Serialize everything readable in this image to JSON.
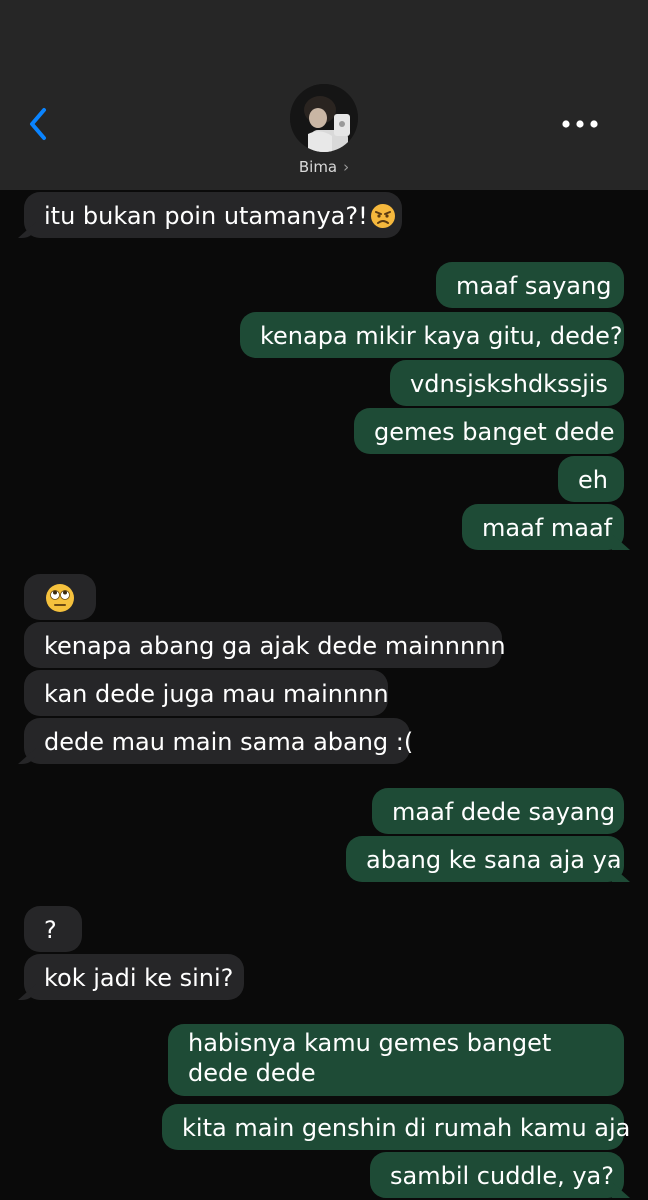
{
  "header": {
    "contact_name": "Bima",
    "contact_chevron": "›",
    "back_icon": "chevron-left-icon",
    "more_icon": "ellipsis-icon",
    "accent_color": "#0a84ff"
  },
  "colors": {
    "sent_bubble": "#1e4b36",
    "received_bubble": "#262628",
    "background": "#0a0a0a",
    "header_bg": "#262626"
  },
  "messages": [
    {
      "dir": "received",
      "text": "itu bukan poin utamanya?!",
      "emoji": "angry-face-icon"
    },
    {
      "dir": "sent",
      "text": "maaf sayang"
    },
    {
      "dir": "sent",
      "text": "kenapa mikir kaya gitu, dede?"
    },
    {
      "dir": "sent",
      "text": "vdnsjskshdkssjis"
    },
    {
      "dir": "sent",
      "text": "gemes banget dede"
    },
    {
      "dir": "sent",
      "text": "eh"
    },
    {
      "dir": "sent",
      "text": "maaf maaf"
    },
    {
      "dir": "received",
      "text": "",
      "emoji": "face-with-rolling-eyes-icon"
    },
    {
      "dir": "received",
      "text": "kenapa abang ga ajak dede mainnnnn"
    },
    {
      "dir": "received",
      "text": "kan dede juga mau mainnnn"
    },
    {
      "dir": "received",
      "text": "dede mau main sama abang :("
    },
    {
      "dir": "sent",
      "text": "maaf dede sayang"
    },
    {
      "dir": "sent",
      "text": "abang ke sana aja ya"
    },
    {
      "dir": "received",
      "text": "?"
    },
    {
      "dir": "received",
      "text": "kok jadi ke sini?"
    },
    {
      "dir": "sent",
      "text": "habisnya kamu gemes banget dede dede"
    },
    {
      "dir": "sent",
      "text": "kita main genshin di rumah kamu aja"
    },
    {
      "dir": "sent",
      "text": "sambil cuddle, ya?"
    }
  ]
}
